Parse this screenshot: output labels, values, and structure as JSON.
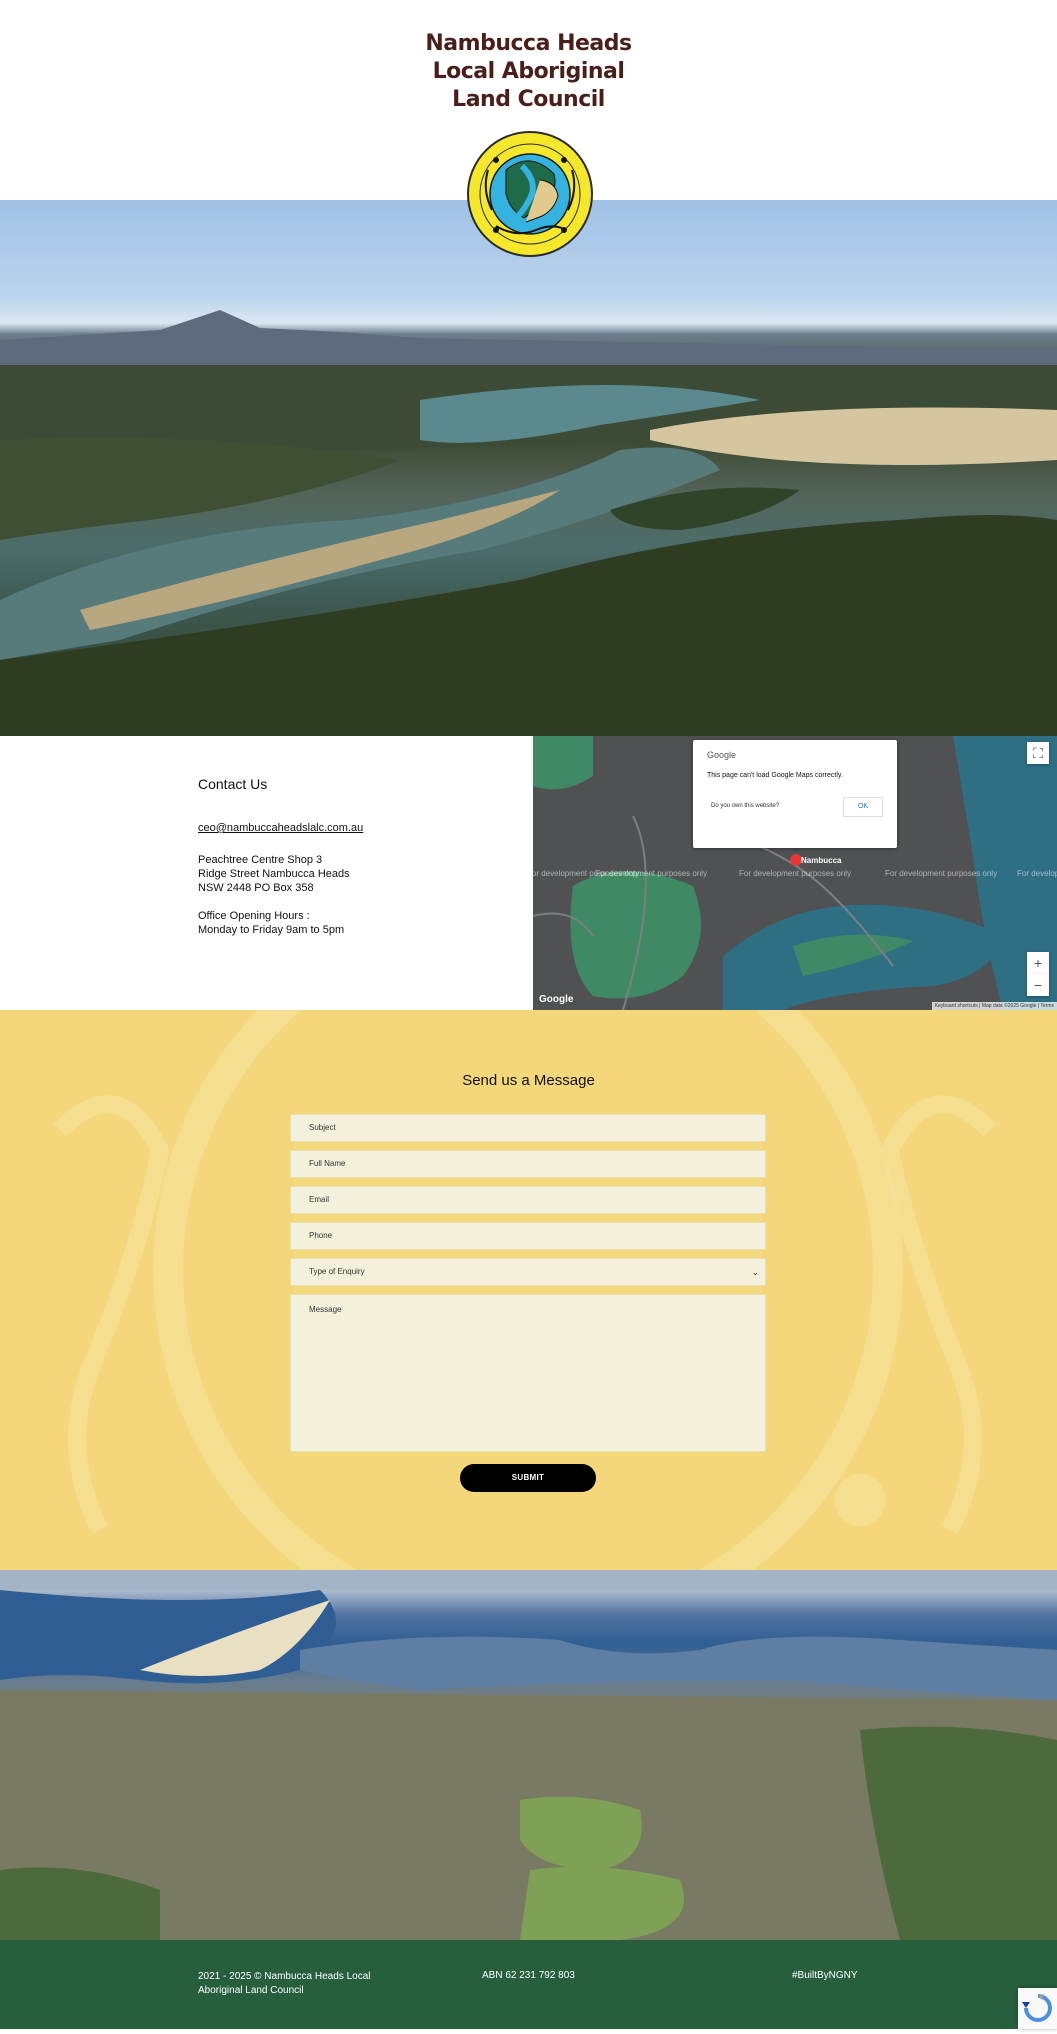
{
  "header": {
    "brand_line1": "Nambucca Heads",
    "brand_line2": "Local Aboriginal",
    "brand_line3": "Land Council"
  },
  "contact": {
    "title": "Contact Us",
    "email": "ceo@nambuccaheadslalc.com.au",
    "address_line1": "Peachtree Centre Shop 3",
    "address_line2": "Ridge Street Nambucca Heads",
    "address_line3": "NSW 2448 PO Box 358",
    "hours_label": "Office Opening Hours :",
    "hours_value": "Monday to Friday 9am to 5pm"
  },
  "map": {
    "google_label": "Google",
    "error_message": "This page can't load Google Maps correctly.",
    "own_website_question": "Do you own this website?",
    "ok_label": "OK",
    "watermark": "For development purposes only",
    "footer_text": "Keyboard shortcuts | Map data ©2025 Google | Terms",
    "place_label": "Nambucca",
    "zoom_in": "+",
    "zoom_out": "−",
    "fullscreen_icon": "⛶"
  },
  "form": {
    "title": "Send us a Message",
    "subject_placeholder": "Subject",
    "fullname_placeholder": "Full Name",
    "email_placeholder": "Email",
    "phone_placeholder": "Phone",
    "enquiry_type_selected": "Type of Enquiry",
    "message_placeholder": "Message",
    "submit_label": "SUBMIT"
  },
  "footer": {
    "copyright": "2021 - 2025 © Nambucca Heads Local Aboriginal Land Council",
    "abn": "ABN 62 231 792 803",
    "hashtag": "#BuiltByNGNY"
  },
  "colors": {
    "brand_text": "#4a1f1a",
    "form_bg": "#f3d77a",
    "footer_bg": "#275f3d",
    "submit_bg": "#000000"
  }
}
